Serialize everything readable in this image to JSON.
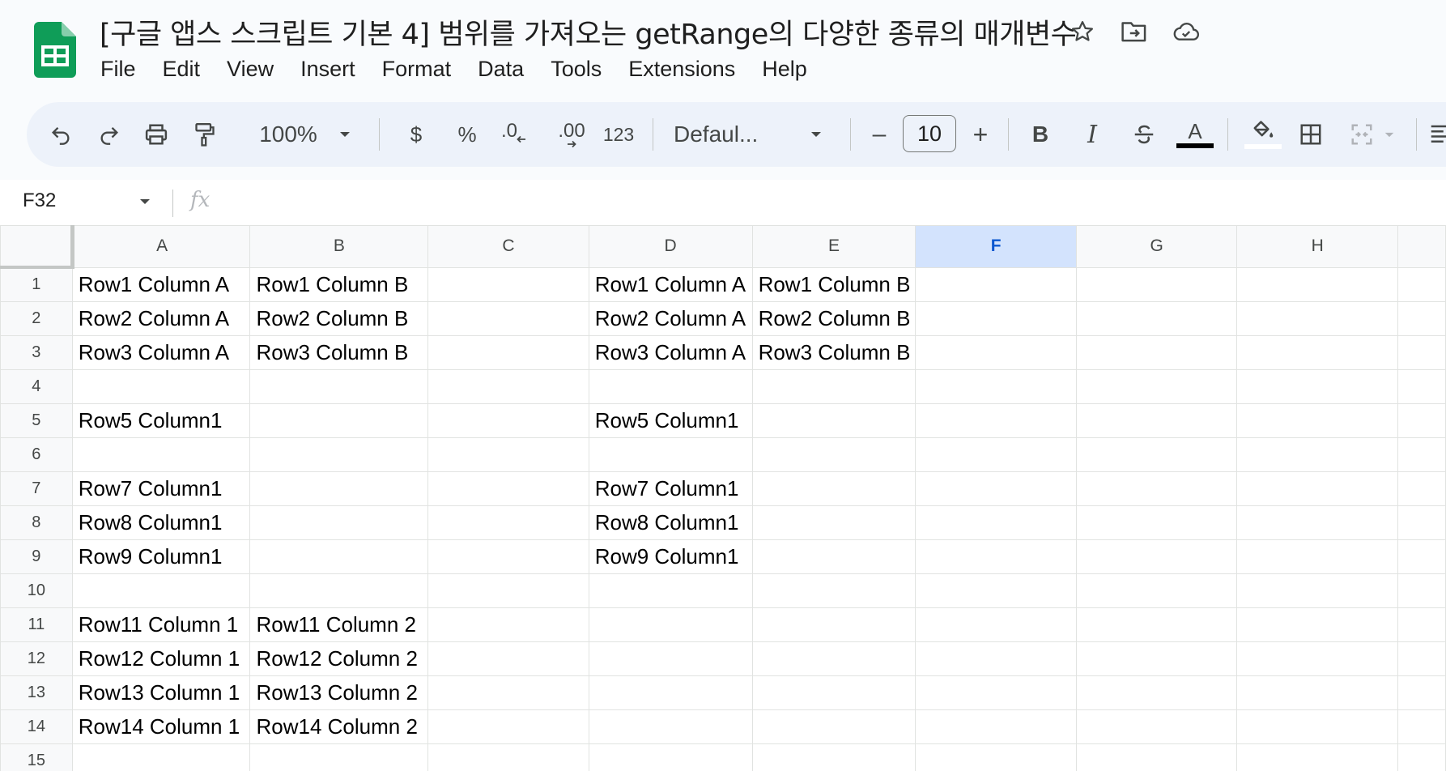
{
  "doc": {
    "title": "[구글 앱스 스크립트 기본 4] 범위를 가져오는 getRange의 다양한 종류의 매개변수",
    "logo_icon": "sheets-logo-icon",
    "title_icons": [
      "star-icon",
      "move-to-folder-icon",
      "cloud-saved-icon"
    ]
  },
  "menu": [
    "File",
    "Edit",
    "View",
    "Insert",
    "Format",
    "Data",
    "Tools",
    "Extensions",
    "Help"
  ],
  "toolbar": {
    "zoom": "100%",
    "currency": "$",
    "percent": "%",
    "decrease_decimal": ".0",
    "increase_decimal": ".00",
    "number_format": "123",
    "font": "Defaul...",
    "font_size": "10",
    "minus": "–",
    "plus": "+"
  },
  "formula_bar": {
    "name_box": "F32",
    "fx": "fx",
    "value": ""
  },
  "columns": [
    "A",
    "B",
    "C",
    "D",
    "E",
    "F",
    "G",
    "H"
  ],
  "selected_column": "F",
  "rows": [
    {
      "n": "1",
      "cells": [
        "Row1 Column A",
        "Row1 Column B",
        "",
        "Row1 Column A",
        "Row1 Column B",
        "",
        "",
        ""
      ]
    },
    {
      "n": "2",
      "cells": [
        "Row2 Column A",
        "Row2 Column B",
        "",
        "Row2 Column A",
        "Row2 Column B",
        "",
        "",
        ""
      ]
    },
    {
      "n": "3",
      "cells": [
        "Row3 Column A",
        "Row3 Column B",
        "",
        "Row3 Column A",
        "Row3 Column B",
        "",
        "",
        ""
      ]
    },
    {
      "n": "4",
      "cells": [
        "",
        "",
        "",
        "",
        "",
        "",
        "",
        ""
      ]
    },
    {
      "n": "5",
      "cells": [
        "Row5 Column1",
        "",
        "",
        "Row5 Column1",
        "",
        "",
        "",
        ""
      ]
    },
    {
      "n": "6",
      "cells": [
        "",
        "",
        "",
        "",
        "",
        "",
        "",
        ""
      ]
    },
    {
      "n": "7",
      "cells": [
        "Row7 Column1",
        "",
        "",
        "Row7 Column1",
        "",
        "",
        "",
        ""
      ]
    },
    {
      "n": "8",
      "cells": [
        "Row8 Column1",
        "",
        "",
        "Row8 Column1",
        "",
        "",
        "",
        ""
      ]
    },
    {
      "n": "9",
      "cells": [
        "Row9 Column1",
        "",
        "",
        "Row9 Column1",
        "",
        "",
        "",
        ""
      ]
    },
    {
      "n": "10",
      "cells": [
        "",
        "",
        "",
        "",
        "",
        "",
        "",
        ""
      ]
    },
    {
      "n": "11",
      "cells": [
        "Row11 Column 1",
        "Row11 Column 2",
        "",
        "",
        "",
        "",
        "",
        ""
      ]
    },
    {
      "n": "12",
      "cells": [
        "Row12 Column 1",
        "Row12 Column 2",
        "",
        "",
        "",
        "",
        "",
        ""
      ]
    },
    {
      "n": "13",
      "cells": [
        "Row13 Column 1",
        "Row13 Column 2",
        "",
        "",
        "",
        "",
        "",
        ""
      ]
    },
    {
      "n": "14",
      "cells": [
        "Row14 Column 1",
        "Row14 Column 2",
        "",
        "",
        "",
        "",
        "",
        ""
      ]
    },
    {
      "n": "15",
      "cells": [
        "",
        "",
        "",
        "",
        "",
        "",
        "",
        ""
      ]
    }
  ]
}
